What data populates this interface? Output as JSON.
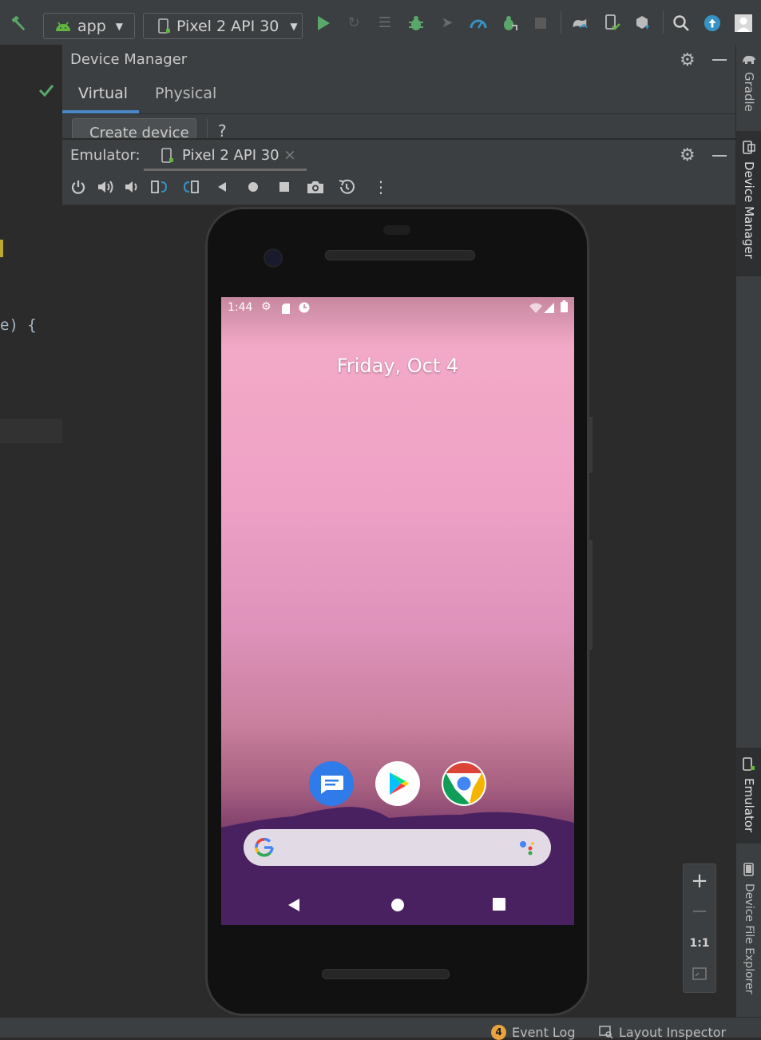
{
  "toolbar": {
    "run_config": "app",
    "device_selector": "Pixel 2 API 30"
  },
  "editor": {
    "code_fragment": "e) {"
  },
  "device_manager": {
    "title": "Device Manager",
    "tabs": [
      {
        "label": "Virtual",
        "active": true
      },
      {
        "label": "Physical",
        "active": false
      }
    ],
    "create_button": "Create device",
    "help": "?"
  },
  "emulator": {
    "label": "Emulator:",
    "tab": "Pixel 2 API 30",
    "close": "×"
  },
  "phone": {
    "time": "1:44",
    "date": "Friday, Oct 4",
    "apps": [
      "messages-icon",
      "play-store-icon",
      "chrome-icon"
    ]
  },
  "zoom": {
    "plus": "+",
    "minus": "−",
    "one_to_one": "1:1"
  },
  "right_rail": {
    "gradle": "Gradle",
    "device_manager": "Device Manager",
    "emulator": "Emulator",
    "device_file_explorer": "Device File Explorer"
  },
  "status_bar": {
    "event_log_count": "4",
    "event_log": "Event Log",
    "layout_inspector": "Layout Inspector"
  },
  "colors": {
    "accent_green": "#499c54",
    "accent_blue": "#3592c4",
    "tab_underline": "#4a88c7"
  }
}
